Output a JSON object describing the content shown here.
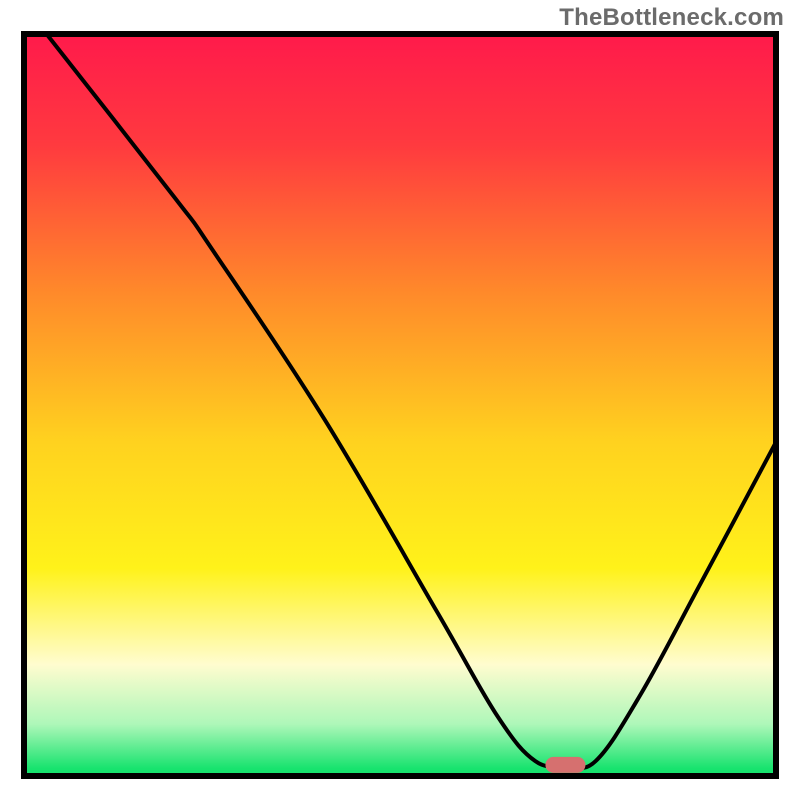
{
  "watermark": "TheBottleneck.com",
  "chart_data": {
    "type": "line",
    "title": "",
    "xlabel": "",
    "ylabel": "",
    "xlim": [
      0,
      100
    ],
    "ylim": [
      0,
      100
    ],
    "grid": false,
    "legend": false,
    "background_gradient": {
      "stops": [
        {
          "offset": 0.0,
          "color": "#ff1a4b"
        },
        {
          "offset": 0.15,
          "color": "#ff3a3f"
        },
        {
          "offset": 0.35,
          "color": "#ff8a2a"
        },
        {
          "offset": 0.55,
          "color": "#ffd21f"
        },
        {
          "offset": 0.72,
          "color": "#fff21a"
        },
        {
          "offset": 0.85,
          "color": "#fffccf"
        },
        {
          "offset": 0.93,
          "color": "#aef7b9"
        },
        {
          "offset": 0.99,
          "color": "#17e36e"
        }
      ]
    },
    "series": [
      {
        "name": "bottleneck-curve",
        "color": "#000000",
        "points": [
          {
            "x": 3.0,
            "y": 100.0
          },
          {
            "x": 20.0,
            "y": 78.0
          },
          {
            "x": 25.0,
            "y": 71.0
          },
          {
            "x": 40.0,
            "y": 48.0
          },
          {
            "x": 55.0,
            "y": 22.0
          },
          {
            "x": 63.0,
            "y": 8.0
          },
          {
            "x": 68.0,
            "y": 2.0
          },
          {
            "x": 72.0,
            "y": 1.5
          },
          {
            "x": 76.0,
            "y": 2.0
          },
          {
            "x": 82.0,
            "y": 11.0
          },
          {
            "x": 90.0,
            "y": 26.0
          },
          {
            "x": 100.0,
            "y": 45.0
          }
        ]
      }
    ],
    "marker": {
      "name": "current-point",
      "x": 72.0,
      "y": 1.5,
      "color": "#d6706f",
      "shape": "pill"
    },
    "frame": {
      "color": "#000000",
      "width": 6
    }
  }
}
